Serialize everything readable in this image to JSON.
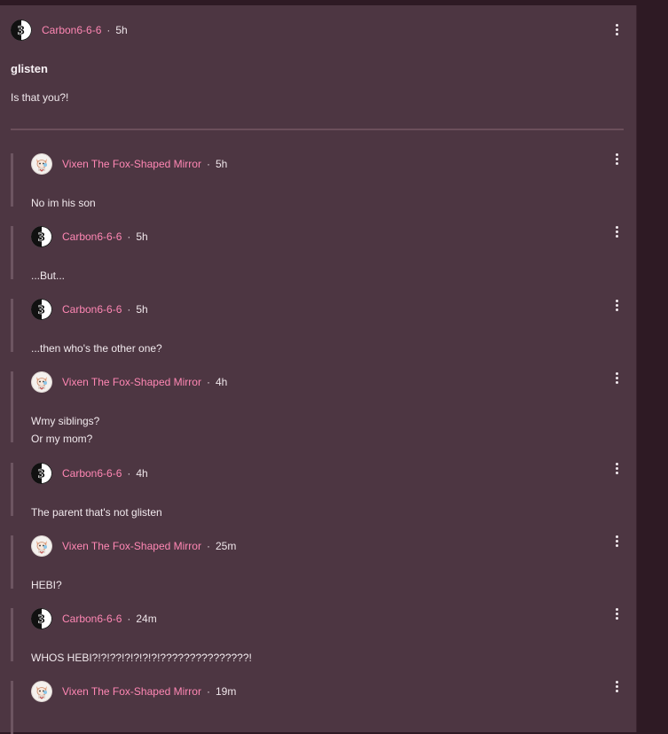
{
  "post": {
    "author": "Carbon6-6-6",
    "separator": "·",
    "time": "5h",
    "title": "glisten",
    "body": "Is that you?!"
  },
  "comments": [
    {
      "author": "Vixen The Fox-Shaped Mirror",
      "time": "5h",
      "lines": [
        "No im his son"
      ]
    },
    {
      "author": "Carbon6-6-6",
      "time": "5h",
      "lines": [
        "...But..."
      ]
    },
    {
      "author": "Carbon6-6-6",
      "time": "5h",
      "lines": [
        "...then who's the other one?"
      ]
    },
    {
      "author": "Vixen The Fox-Shaped Mirror",
      "time": "4h",
      "lines": [
        "Wmy siblings?",
        "Or my mom?"
      ]
    },
    {
      "author": "Carbon6-6-6",
      "time": "4h",
      "lines": [
        "The parent that's not glisten"
      ]
    },
    {
      "author": "Vixen The Fox-Shaped Mirror",
      "time": "25m",
      "lines": [
        "HEBI?"
      ]
    },
    {
      "author": "Carbon6-6-6",
      "time": "24m",
      "lines": [
        "WHOS HEBI?!?!??!?!?!?!?!???????????????!"
      ]
    },
    {
      "author": "Vixen The Fox-Shaped Mirror",
      "time": "19m",
      "lines": []
    }
  ],
  "icons": {
    "menu": "more-vertical-icon",
    "avatar_carbon": "black-white-split-avatar",
    "avatar_vixen": "fox-avatar"
  },
  "colors": {
    "background": "#2e1a24",
    "card": "#4d3642",
    "author": "#ff87b4",
    "text": "#f1e9ed",
    "rail": "#6d5561"
  }
}
